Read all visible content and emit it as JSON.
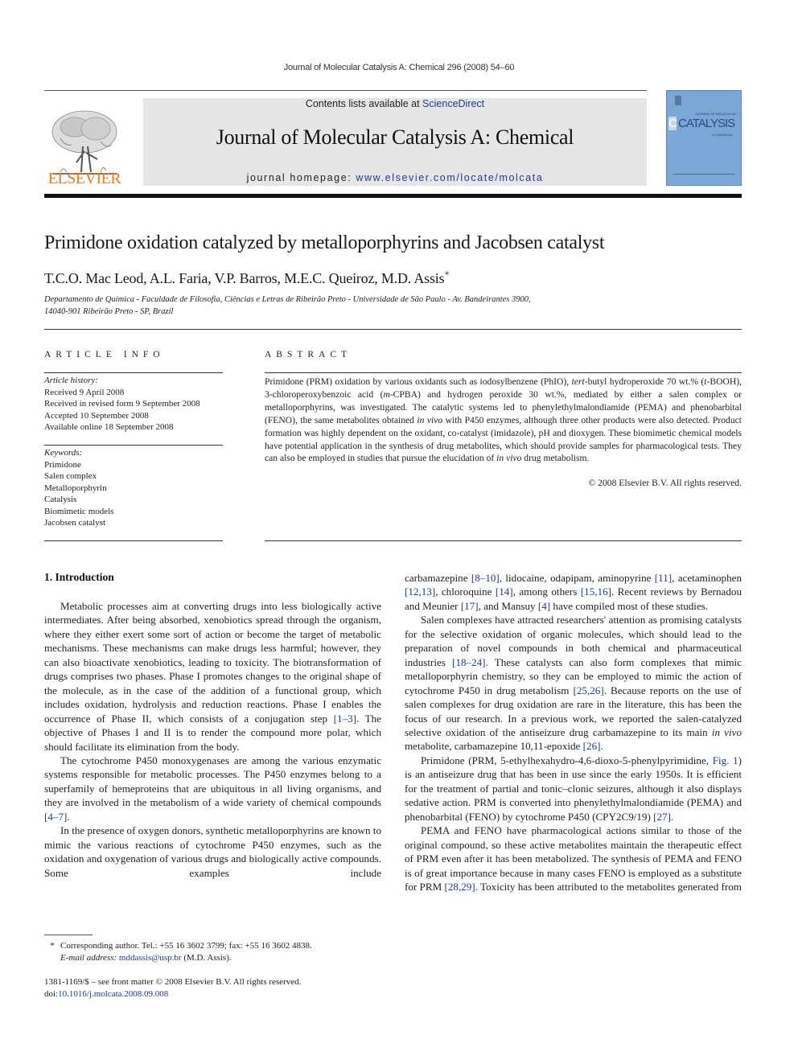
{
  "running_head": "Journal of Molecular Catalysis A: Chemical 296 (2008) 54–60",
  "banner": {
    "contents_prefix": "Contents lists available at ",
    "contents_link": "ScienceDirect",
    "journal_name": "Journal of Molecular Catalysis A: Chemical",
    "homepage_prefix": "journal homepage: ",
    "homepage_link": "www.elsevier.com/locate/molcata",
    "publisher": "ELSEVIER",
    "cover_title": "CATALYSIS",
    "cover_letter": "C",
    "cover_small": "JOURNAL OF MOLECULAR",
    "cover_sub": "A: CHEMICAL",
    "publisher_color": "#f07d1a",
    "cover_color": "#7ba7d6",
    "link_color": "#1f3a93"
  },
  "article": {
    "title": "Primidone oxidation catalyzed by metalloporphyrins and Jacobsen catalyst",
    "authors": "T.C.O. Mac Leod, A.L. Faria, V.P. Barros, M.E.C. Queiroz, M.D. Assis",
    "author_mark": "*",
    "affiliation_line1": "Departamento de Química - Faculdade de Filosofia, Ciências e Letras de Ribeirão Preto - Universidade de São Paulo - Av. Bandeirantes 3900,",
    "affiliation_line2": "14040-901 Ribeirão Preto - SP, Brazil"
  },
  "article_info": {
    "heading": "ARTICLE INFO",
    "history_label": "Article history:",
    "history": [
      "Received 9 April 2008",
      "Received in revised form 9 September 2008",
      "Accepted 10 September 2008",
      "Available online 18 September 2008"
    ],
    "keywords_label": "Keywords:",
    "keywords": [
      "Primidone",
      "Salen complex",
      "Metalloporphyrin",
      "Catalysis",
      "Biomimetic models",
      "Jacobsen catalyst"
    ]
  },
  "abstract": {
    "heading": "ABSTRACT",
    "s1": "Primidone (PRM) oxidation by various oxidants such as iodosylbenzene (PhIO), ",
    "s1_it": "tert",
    "s2": "-butyl hydroperoxide 70 wt.% (",
    "s2_it": "t",
    "s3": "-BOOH), 3-chloroperoxybenzoic acid (",
    "s3_it": "m",
    "s4": "-CPBA) and hydrogen peroxide 30 wt.%, mediated by either a salen complex or metalloporphyrins, was investigated. The catalytic systems led to phenylethylmalondiamide (PEMA) and phenobarbital (FENO), the same metabolites obtained ",
    "s4_it": "in vivo",
    "s5": " with P450 enzymes, although three other products were also detected. Product formation was highly dependent on the oxidant, co-catalyst (imidazole), pH and dioxygen. These biomimetic chemical models have potential application in the synthesis of drug metabolites, which should provide samples for pharmacological tests. They can also be employed in studies that pursue the elucidation of ",
    "s5_it": "in vivo",
    "s6": " drug metabolism.",
    "copyright": "© 2008 Elsevier B.V. All rights reserved."
  },
  "intro": {
    "heading": "1.  Introduction",
    "p1a": "Metabolic processes aim at converting drugs into less biologically active intermediates. After being absorbed, xenobiotics spread through the organism, where they either exert some sort of action or become the target of metabolic mechanisms. These mechanisms can make drugs less harmful; however, they can also bioactivate xenobiotics, leading to toxicity. The biotransformation of drugs comprises two phases. Phase I promotes changes to the original shape of the molecule, as in the case of the addition of a functional group, which includes oxidation, hydrolysis and reduction reactions. Phase I enables the occurrence of Phase II, which consists of a conjugation step ",
    "p1_ref": "[1–3]",
    "p1b": ". The objective of Phases I and II is to render the compound more polar, which should facilitate its elimination from the body.",
    "p2a": "The cytochrome P450 monoxygenases are among the various enzymatic systems responsible for metabolic processes. The P450 enzymes belong to a superfamily of hemeproteins that are ubiquitous in all living organisms, and they are involved in the metabolism of a wide variety of chemical compounds ",
    "p2_ref": "[4–7]",
    "p2b": ".",
    "p3": "In the presence of oxygen donors, synthetic metalloporphyrins are known to mimic the various reactions of cytochrome P450 enzymes, such as the oxidation and oxygenation of various drugs and biologically active compounds. Some examples include",
    "r1a": "carbamazepine ",
    "r1_ref1": "[8–10]",
    "r1b": ", lidocaine, odapipam, aminopyrine ",
    "r1_ref2": "[11]",
    "r1c": ", acetaminophen ",
    "r1_ref3": "[12,13]",
    "r1d": ", chloroquine ",
    "r1_ref4": "[14]",
    "r1e": ", among others ",
    "r1_ref5": "[15,16]",
    "r1f": ". Recent reviews by Bernadou and Meunier ",
    "r1_ref6": "[17]",
    "r1g": ", and Mansuy ",
    "r1_ref7": "[4]",
    "r1h": " have compiled most of these studies.",
    "r2a": "Salen complexes have attracted researchers' attention as promising catalysts for the selective oxidation of organic molecules, which should lead to the preparation of novel compounds in both chemical and pharmaceutical industries ",
    "r2_ref1": "[18–24]",
    "r2b": ". These catalysts can also form complexes that mimic metalloporphyrin chemistry, so they can be employed to mimic the action of cytochrome P450 in drug metabolism ",
    "r2_ref2": "[25,26]",
    "r2c": ". Because reports on the use of salen complexes for drug oxidation are rare in the literature, this has been the focus of our research. In a previous work, we reported the salen-catalyzed selective oxidation of the antiseizure drug carbamazepine to its main ",
    "r2_it": "in vivo",
    "r2d": " metabolite, carbamazepine 10,11-epoxide ",
    "r2_ref3": "[26]",
    "r2e": ".",
    "r3a": "Primidone (PRM, 5-ethylhexahydro-4,6-dioxo-5-phenylpyrimidine, ",
    "r3_fig": "Fig. 1",
    "r3b": ") is an antiseizure drug that has been in use since the early 1950s. It is efficient for the treatment of partial and tonic–clonic seizures, although it also displays sedative action. PRM is converted into phenylethylmalondiamide (PEMA) and phenobarbital (FENO) by cytochrome P450 (CPY2C9/19) ",
    "r3_ref": "[27]",
    "r3c": ".",
    "r4a": "PEMA and FENO have pharmacological actions similar to those of the original compound, so these active metabolites maintain the therapeutic effect of PRM even after it has been metabolized. The synthesis of PEMA and FENO is of great importance because in many cases FENO is employed as a substitute for PRM ",
    "r4_ref": "[28,29]",
    "r4b": ". Toxicity has been attributed to the metabolites generated from"
  },
  "footnote": {
    "star": "*",
    "line1": "Corresponding author. Tel.: +55 16 3602 3799; fax: +55 16 3602 4838.",
    "email_label": "E-mail address: ",
    "email": "mddassis@usp.br",
    "email_suffix": " (M.D. Assis)."
  },
  "front_matter": {
    "issn_line": "1381-1169/$ – see front matter © 2008 Elsevier B.V. All rights reserved.",
    "doi_prefix": "doi:",
    "doi": "10.1016/j.molcata.2008.09.008"
  }
}
